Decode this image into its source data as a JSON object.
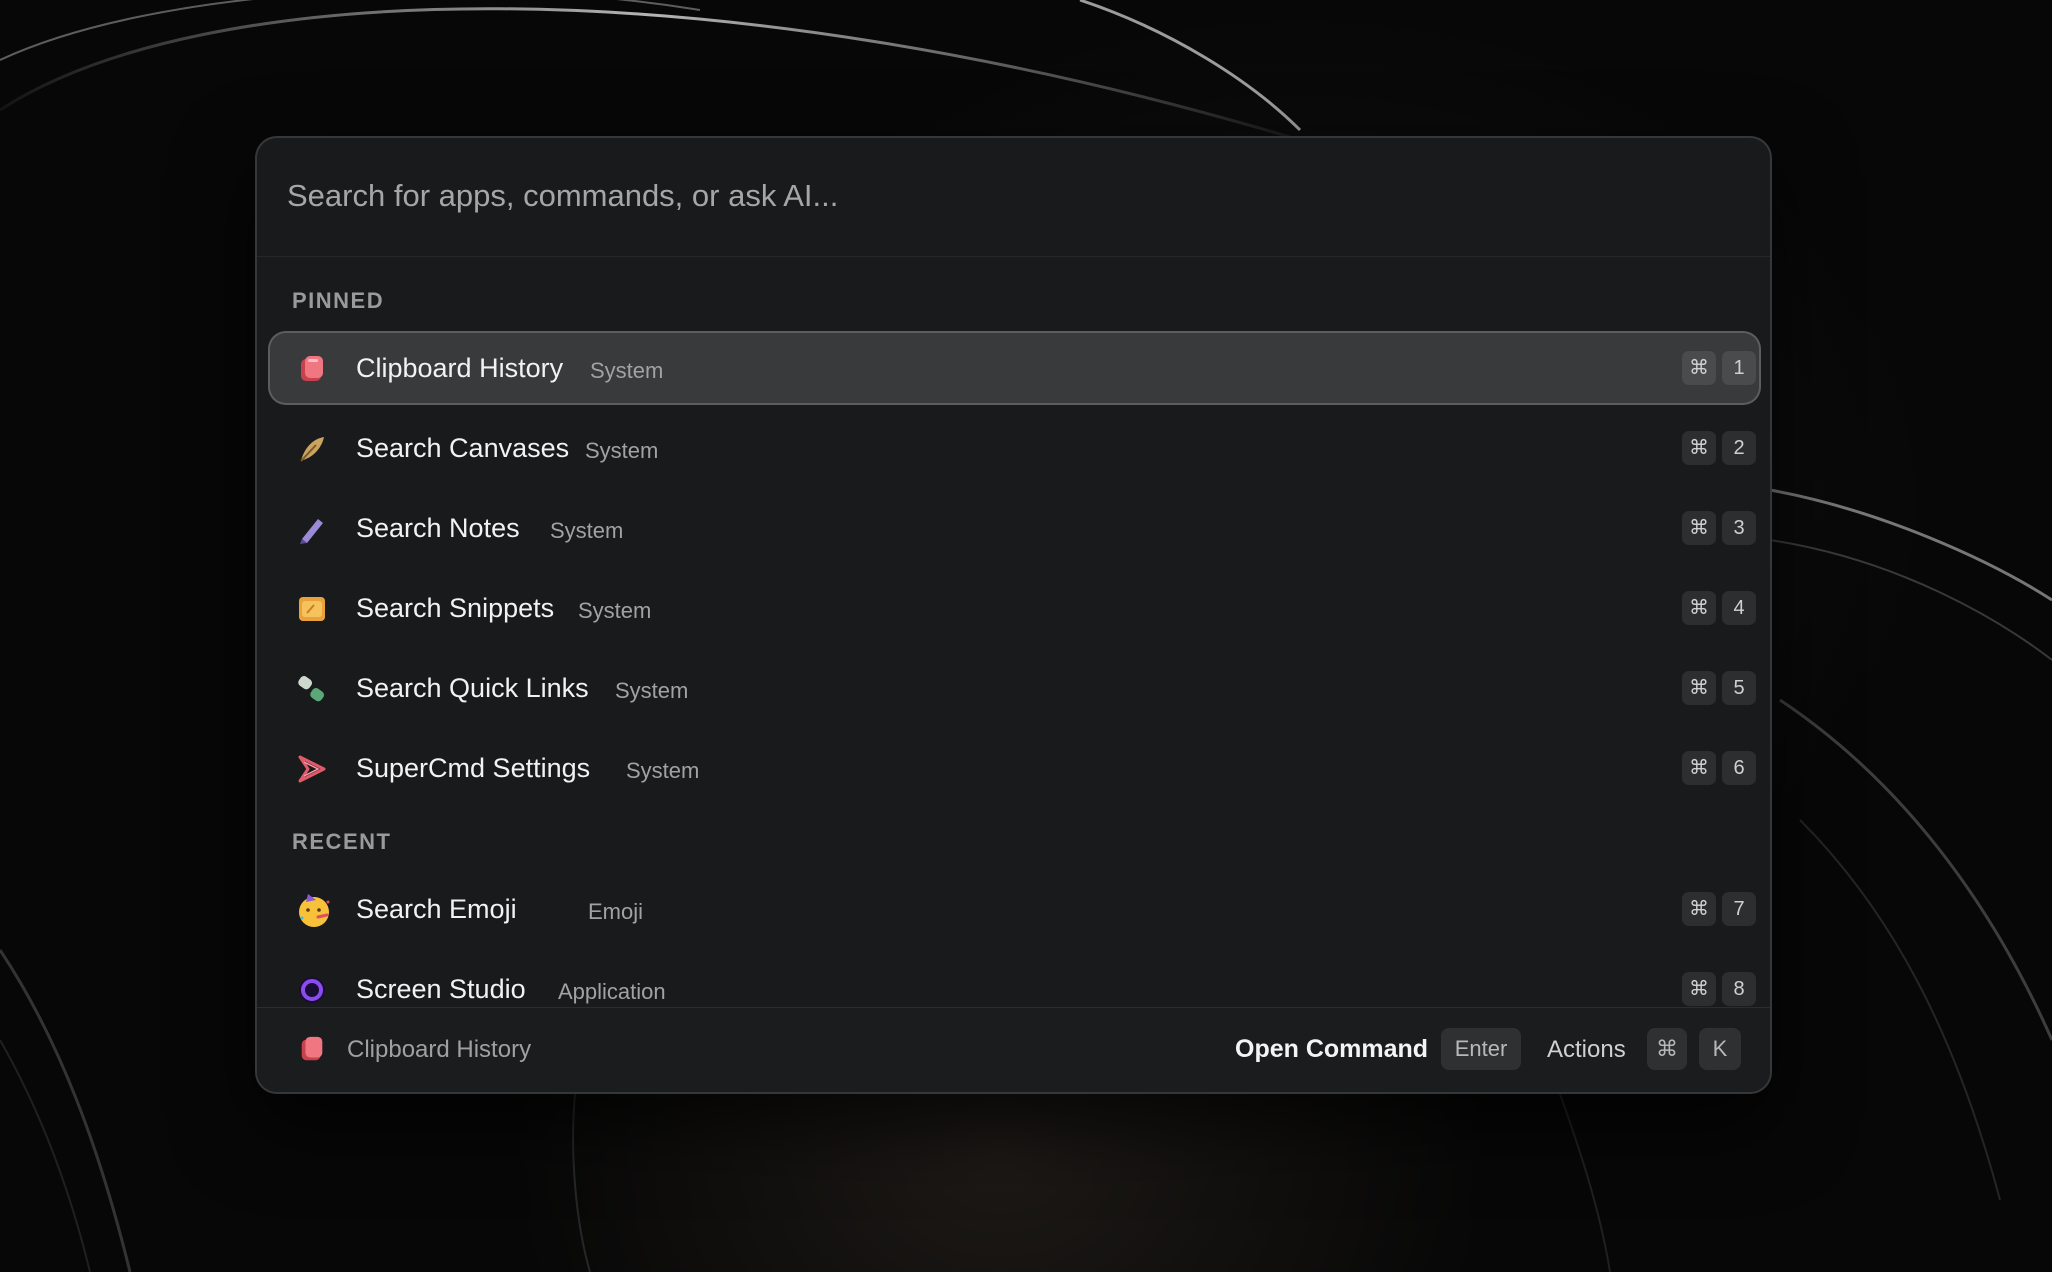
{
  "search": {
    "placeholder": "Search for apps, commands, or ask AI..."
  },
  "sections": {
    "pinned": "PINNED",
    "recent": "RECENT"
  },
  "items": [
    {
      "title": "Clipboard History",
      "subtitle": "System",
      "icon": "clipboard-history-icon",
      "modifier": "⌘",
      "key": "1",
      "selected": true
    },
    {
      "title": "Search Canvases",
      "subtitle": "System",
      "icon": "canvas-feather-icon",
      "modifier": "⌘",
      "key": "2"
    },
    {
      "title": "Search Notes",
      "subtitle": "System",
      "icon": "notes-pen-icon",
      "modifier": "⌘",
      "key": "3"
    },
    {
      "title": "Search Snippets",
      "subtitle": "System",
      "icon": "snippets-folder-icon",
      "modifier": "⌘",
      "key": "4"
    },
    {
      "title": "Search Quick Links",
      "subtitle": "System",
      "icon": "quick-links-icon",
      "modifier": "⌘",
      "key": "5"
    },
    {
      "title": "SuperCmd Settings",
      "subtitle": "System",
      "icon": "supercmd-logo-icon",
      "modifier": "⌘",
      "key": "6"
    },
    {
      "title": "Search Emoji",
      "subtitle": "Emoji",
      "icon": "party-face-emoji-icon",
      "modifier": "⌘",
      "key": "7"
    },
    {
      "title": "Screen Studio",
      "subtitle": "Application",
      "icon": "screen-studio-icon",
      "modifier": "⌘",
      "key": "8"
    }
  ],
  "footer": {
    "selected_label": "Clipboard History",
    "primary_action": "Open Command",
    "primary_key": "Enter",
    "actions_label": "Actions",
    "actions_modifier": "⌘",
    "actions_key": "K"
  },
  "colors": {
    "background": "#070707",
    "panel": "#1a1b1d",
    "selected_row": "#3a3b3d",
    "text_primary": "#f2f2f2",
    "text_secondary": "#a2a2a4"
  }
}
